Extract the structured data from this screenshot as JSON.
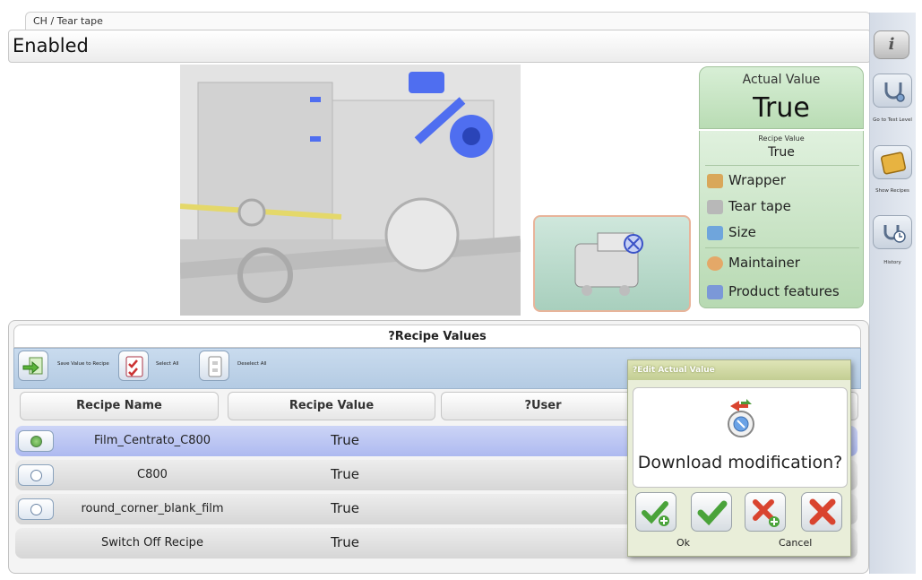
{
  "header": {
    "breadcrumb": "CH / Tear tape",
    "title": "Enabled",
    "info_icon": "info-icon",
    "info_glyph": "i"
  },
  "value_panel": {
    "actual_label": "Actual Value",
    "actual_value": "True",
    "recipe_label": "Recipe Value",
    "recipe_value": "True",
    "features": [
      {
        "label": "Wrapper",
        "icon": "wrapper-icon"
      },
      {
        "label": "Tear tape",
        "icon": "tear-tape-icon"
      },
      {
        "label": "Size",
        "icon": "size-icon"
      },
      {
        "label": "Maintainer",
        "icon": "maintainer-icon"
      },
      {
        "label": "Product features",
        "icon": "product-features-icon"
      }
    ]
  },
  "sidebar": {
    "items": [
      {
        "label": "Go to Test Level",
        "icon": "stethoscope-icon"
      },
      {
        "label": "Show Recipes",
        "icon": "recipe-book-icon"
      },
      {
        "label": "History",
        "icon": "history-icon"
      }
    ]
  },
  "recipe_values": {
    "title": "?Recipe Values",
    "toolbar": {
      "save_label": "Save Value to Recipe",
      "select_all_label": "Select All",
      "deselect_all_label": "Deselect All"
    },
    "columns": [
      "Recipe Name",
      "Recipe Value",
      "?User"
    ],
    "rows": [
      {
        "name": "Film_Centrato_C800",
        "value": "True",
        "selected": true
      },
      {
        "name": "C800",
        "value": "True",
        "selected": false
      },
      {
        "name": "round_corner_blank_film",
        "value": "True",
        "selected": false
      },
      {
        "name": "Switch Off Recipe",
        "value": "True",
        "selected": false
      }
    ]
  },
  "dialog": {
    "title": "?Edit Actual Value",
    "message": "Download modification?",
    "ok_label": "Ok",
    "cancel_label": "Cancel"
  },
  "colors": {
    "accent_green": "#b9dcb4",
    "selected_row": "#aebaf0",
    "toolbar_blue": "#b4cbe3"
  }
}
